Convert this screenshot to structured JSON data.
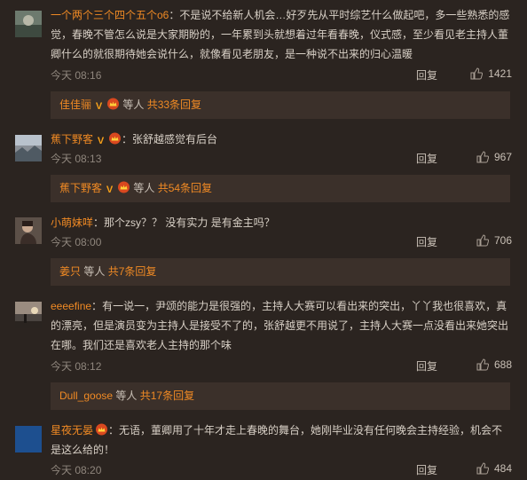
{
  "comments": [
    {
      "user": "一个两个三个四个五个o6",
      "sep": "：",
      "text": "不是说不给新人机会…好歹先从平时综艺什么做起吧，多一些熟悉的感觉，春晚不管怎么说是大家期盼的，一年累到头就想着过年看春晚，仪式感，至少看见老主持人董卿什么的就很期待她会说什么，就像看见老朋友，是一种说不出来的归心温暖",
      "time": "今天 08:16",
      "reply_label": "回复",
      "likes": "1421",
      "sub": {
        "name": "佳佳骊",
        "etc": " 等人 ",
        "total": "共33条回复"
      }
    },
    {
      "user": "蕉下野客",
      "sep": "：",
      "text": "张舒越感觉有后台",
      "time": "今天 08:13",
      "reply_label": "回复",
      "likes": "967",
      "sub": {
        "name": "蕉下野客",
        "etc": " 等人 ",
        "total": "共54条回复"
      }
    },
    {
      "user": "小萌妹咩",
      "sep": "：",
      "text": "那个zsy？？ 没有实力 是有金主吗？",
      "time": "今天 08:00",
      "reply_label": "回复",
      "likes": "706",
      "sub": {
        "name": "姜只",
        "etc": " 等人 ",
        "total": "共7条回复"
      }
    },
    {
      "user": "eeeefine",
      "sep": "：",
      "text": "有一说一，尹颂的能力是很强的，主持人大赛可以看出来的突出，丫丫我也很喜欢，真的漂亮，但是演员变为主持人是接受不了的，张舒越更不用说了，主持人大赛一点没看出来她突出在哪。我们还是喜欢老人主持的那个味",
      "time": "今天 08:12",
      "reply_label": "回复",
      "likes": "688",
      "sub": {
        "name": "Dull_goose",
        "etc": " 等人 ",
        "total": "共17条回复"
      }
    },
    {
      "user": "星夜无晏",
      "sep": "：",
      "text": "无语，董卿用了十年才走上春晚的舞台，她刚毕业没有任何晚会主持经验，机会不是这么给的！",
      "time": "今天 08:20",
      "reply_label": "回复",
      "likes": "484"
    }
  ]
}
